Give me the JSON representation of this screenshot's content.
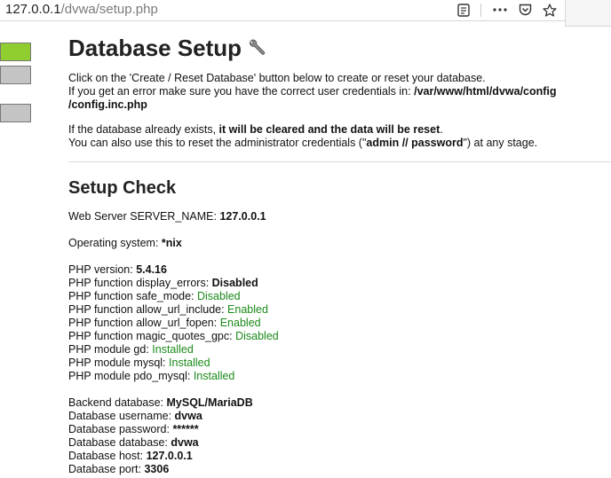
{
  "browser": {
    "url_host": "127.0.0.1",
    "url_path": "/dvwa/setup.php"
  },
  "sidebar": {
    "buttons": [
      {
        "color": "#8fce2e"
      },
      {
        "color": "#c4c4c4"
      },
      {
        "color": "#c4c4c4"
      }
    ]
  },
  "page": {
    "title": "Database Setup",
    "intro_line1": "Click on the 'Create / Reset Database' button below to create or reset your database.",
    "intro_line2_prefix": "If you get an error make sure you have the correct user credentials in: ",
    "config_path_1": "/var/www/html/dvwa/config",
    "config_path_2": "/config.inc.php",
    "warn_prefix": "If the database already exists, ",
    "warn_bold": "it will be cleared and the data will be reset",
    "warn_suffix": ".",
    "reset_prefix": "You can also use this to reset the administrator credentials (\"",
    "reset_cred": "admin // password",
    "reset_suffix": "\") at any stage.",
    "setup_check_title": "Setup Check"
  },
  "checks": {
    "server_name_label": "Web Server SERVER_NAME: ",
    "server_name_value": "127.0.0.1",
    "os_label": "Operating system: ",
    "os_value": "*nix",
    "php": [
      {
        "label": "PHP version: ",
        "value": "5.4.16",
        "style": "bold"
      },
      {
        "label": "PHP function display_errors: ",
        "value": "Disabled",
        "style": "bold"
      },
      {
        "label": "PHP function safe_mode: ",
        "value": "Disabled",
        "style": "green"
      },
      {
        "label": "PHP function allow_url_include: ",
        "value": "Enabled",
        "style": "green"
      },
      {
        "label": "PHP function allow_url_fopen: ",
        "value": "Enabled",
        "style": "green"
      },
      {
        "label": "PHP function magic_quotes_gpc: ",
        "value": "Disabled",
        "style": "green"
      },
      {
        "label": "PHP module gd: ",
        "value": "Installed",
        "style": "green"
      },
      {
        "label": "PHP module mysql: ",
        "value": "Installed",
        "style": "green"
      },
      {
        "label": "PHP module pdo_mysql: ",
        "value": "Installed",
        "style": "green"
      }
    ],
    "db": [
      {
        "label": "Backend database: ",
        "value": "MySQL/MariaDB"
      },
      {
        "label": "Database username: ",
        "value": "dvwa"
      },
      {
        "label": "Database password: ",
        "value": "******"
      },
      {
        "label": "Database database: ",
        "value": "dvwa"
      },
      {
        "label": "Database host: ",
        "value": "127.0.0.1"
      },
      {
        "label": "Database port: ",
        "value": "3306"
      }
    ]
  },
  "colors": {
    "enabled_green": "#1a8a1a",
    "accent_green": "#8fce2e"
  }
}
